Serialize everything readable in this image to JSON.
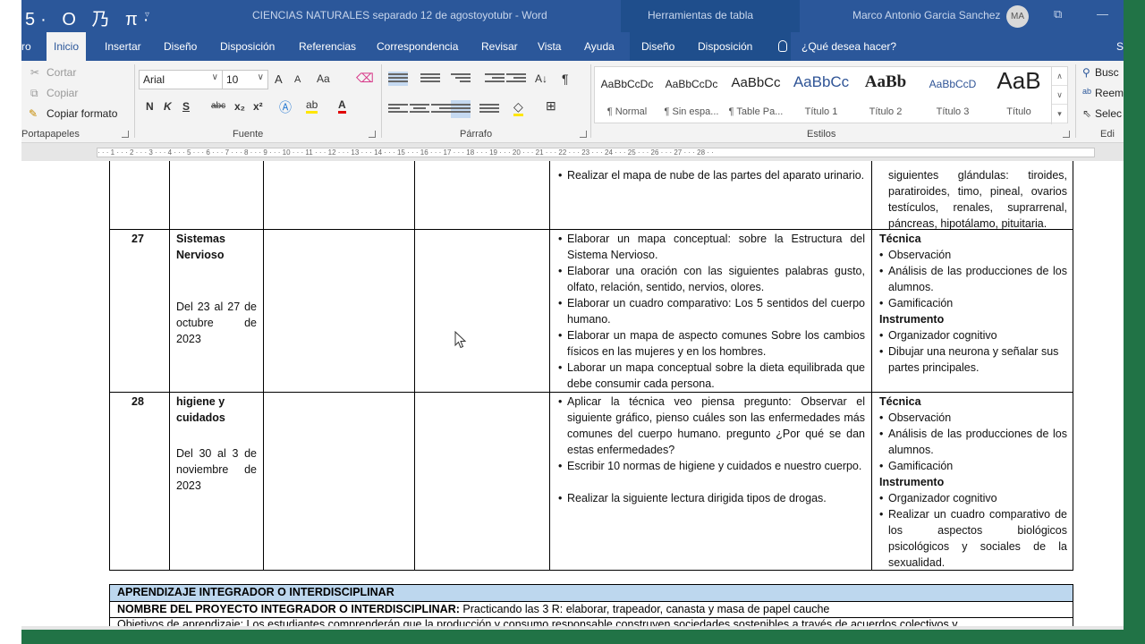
{
  "titlebar": {
    "quick_access": "5· O 乃 π·",
    "quick_access_dropdown": "▿",
    "document_title": "CIENCIAS NATURALES separado 12 de agostoyotubr - Word",
    "context_tools": "Herramientas de tabla",
    "user_name": "Marco Antonio Garcia Sanchez",
    "user_initials": "MA",
    "restore_icon": "⧉",
    "minimize_icon": "—"
  },
  "tabs": {
    "file_partial": "ro",
    "items": [
      "Inicio",
      "Insertar",
      "Diseño",
      "Disposición",
      "Referencias",
      "Correspondencia",
      "Revisar",
      "Vista",
      "Ayuda",
      "Diseño",
      "Disposición"
    ],
    "tell_me": "¿Qué desea hacer?",
    "share_partial": "S"
  },
  "ribbon": {
    "clipboard": {
      "cut": "Cortar",
      "copy": "Copiar",
      "format_painter": "Copiar formato",
      "label": "Portapapeles"
    },
    "font": {
      "font_name": "Arial",
      "font_size": "10",
      "grow": "A",
      "shrink": "A",
      "change_case": "Aa",
      "bold": "N",
      "italic": "K",
      "underline": "S",
      "strike": "abc",
      "subscript": "x₂",
      "superscript": "x²",
      "label": "Fuente"
    },
    "paragraph": {
      "sort": "A↓",
      "pilcrow": "¶",
      "label": "Párrafo"
    },
    "styles": {
      "label": "Estilos",
      "items": [
        {
          "sample": "AaBbCcDc",
          "name": "¶ Normal"
        },
        {
          "sample": "AaBbCcDc",
          "name": "¶ Sin espa..."
        },
        {
          "sample": "AaBbCc",
          "name": "¶ Table Pa..."
        },
        {
          "sample": "AaBbCc",
          "name": "Título 1"
        },
        {
          "sample": "AaBb",
          "name": "Título 2"
        },
        {
          "sample": "AaBbCcD",
          "name": "Título 3"
        },
        {
          "sample": "AaB",
          "name": "Título"
        }
      ]
    },
    "editing": {
      "find": "Busc",
      "replace": "Reem",
      "select": "Selec",
      "label": "Edi"
    }
  },
  "ruler": {
    "text": "· · · 1 · · · 2 · · · 3 · · · 4 · · · 5 · · · 6 · · · 7 · · · 8 · · · 9 · · · 10 · · · 11 · · · 12 · · · 13 · · · 14 · · · 15 · · · 16 · · · 17 · · · 18 · · · 19 · · · 20 · · · 21 · · · 22 · · · 23 · · · 24 · · · 25 · · · 26 · · · 27 · · · 28 · ·"
  },
  "table": {
    "row_prev": {
      "activity": "Realizar el mapa de nube de las partes del aparato urinario.",
      "eval_text": "siguientes glándulas: tiroides, paratiroides, timo, pineal, ovarios testículos, renales, suprarrenal, páncreas, hipotálamo, pituitaria."
    },
    "row27": {
      "num": "27",
      "topic": "Sistemas Nervioso",
      "dates": "Del 23 al 27 de octubre de 2023",
      "activities": [
        "Elaborar un mapa conceptual: sobre la Estructura del Sistema Nervioso.",
        "Elaborar una oración con las siguientes palabras gusto, olfato, relación, sentido, nervios, olores.",
        "Elaborar un cuadro comparativo: Los 5 sentidos del cuerpo humano.",
        "Elaborar un mapa de aspecto comunes Sobre los cambios físicos en las mujeres y en los hombres.",
        "Laborar un mapa conceptual sobre la dieta equilibrada que debe consumir cada persona."
      ],
      "tecnica_label": "Técnica",
      "tecnica": [
        "Observación",
        "Análisis de las producciones de los alumnos.",
        "Gamificación"
      ],
      "instrumento_label": "Instrumento",
      "instrumento": [
        "Organizador cognitivo",
        "Dibujar una neurona y señalar sus partes principales."
      ]
    },
    "row28": {
      "num": "28",
      "topic": "higiene y cuidados",
      "dates": "Del 30 al 3 de noviembre de 2023",
      "activities": [
        "Aplicar la técnica veo piensa pregunto: Observar el siguiente gráfico, pienso cuáles son las enfermedades más comunes del cuerpo humano. pregunto ¿Por qué se dan estas enfermedades?",
        "Escribir 10 normas de higiene y cuidados e nuestro cuerpo.",
        "Realizar la siguiente lectura dirigida tipos de drogas."
      ],
      "tecnica_label": "Técnica",
      "tecnica": [
        "Observación",
        "Análisis de las producciones de los alumnos.",
        "Gamificación"
      ],
      "instrumento_label": "Instrumento",
      "instrumento": [
        "Organizador cognitivo",
        "Realizar un cuadro comparativo de los aspectos biológicos psicológicos y sociales de la sexualidad."
      ]
    }
  },
  "integrador": {
    "heading": "APRENDIZAJE INTEGRADOR O INTERDISCIPLINAR",
    "project_label": "NOMBRE DEL PROYECTO INTEGRADOR O INTERDISCIPLINAR:",
    "project_name": "Practicando las 3 R: elaborar, trapeador, canasta y masa de papel cauche",
    "objectives": "Objetivos de aprendizaje: Los estudiantes comprenderán que la producción y consumo responsable construyen sociedades sostenibles a través de acuerdos colectivos y"
  },
  "colors": {
    "word_blue": "#2b579a",
    "ribbon_bg": "#f3f3f3",
    "status_green": "#217346",
    "table_header_blue": "#bdd7ee"
  }
}
